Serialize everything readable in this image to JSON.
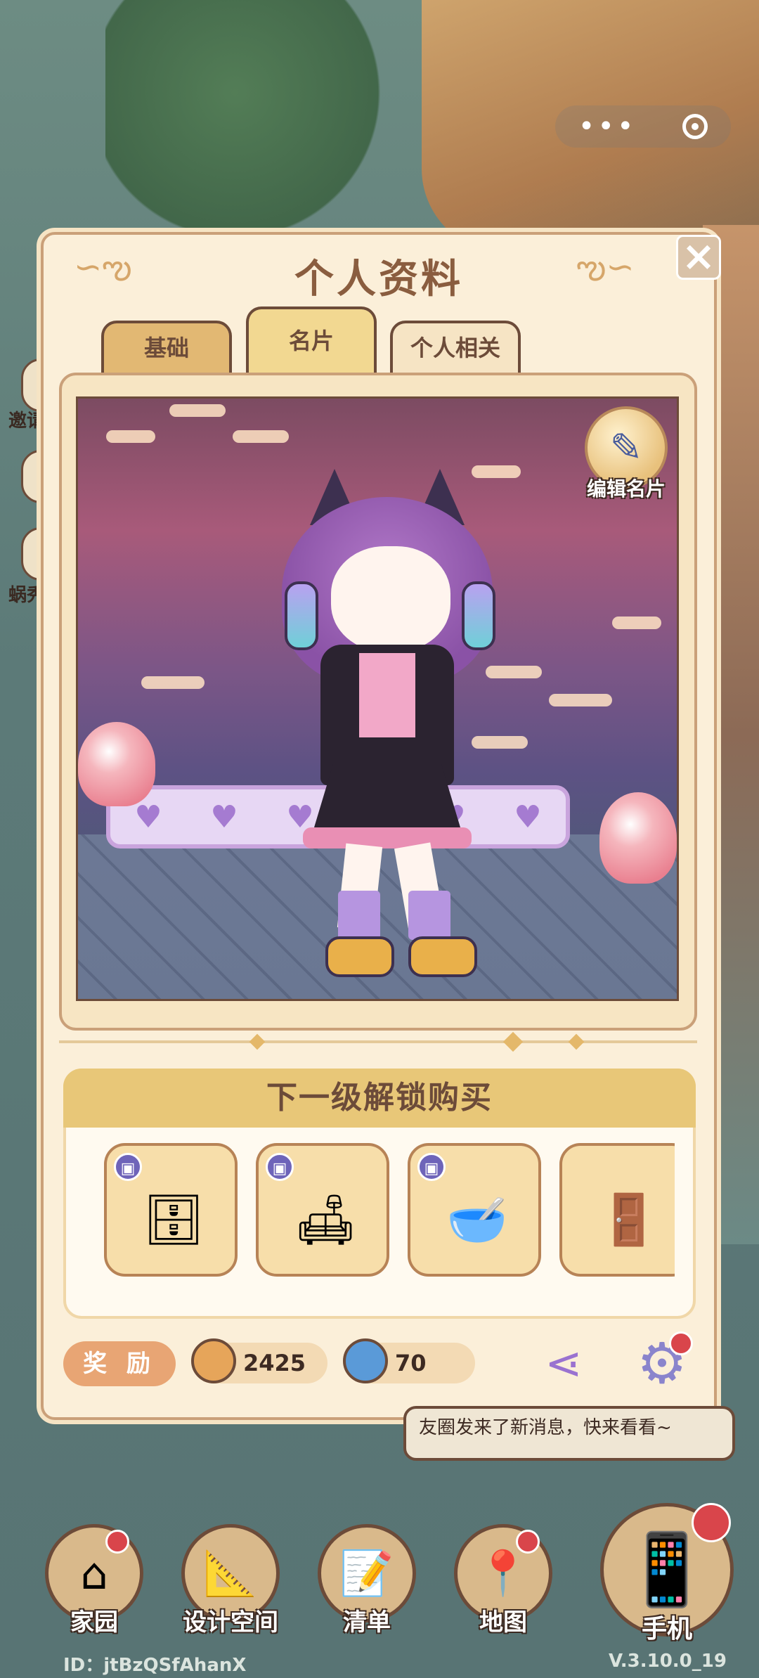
{
  "top_bar": {
    "menu_icon": "more-dots-icon",
    "record_icon": "target-icon"
  },
  "side": {
    "invite_label": "邀请",
    "snail_label": "蜗秀"
  },
  "panel": {
    "title": "个人资料",
    "close_icon": "close-icon",
    "tabs": [
      {
        "label": "基础",
        "active": false
      },
      {
        "label": "名片",
        "active": true
      },
      {
        "label": "个人相关",
        "active": false
      }
    ],
    "edit_card_label": "编辑名片",
    "unlock": {
      "title": "下一级解锁购买",
      "items": [
        {
          "icon": "stove-icon"
        },
        {
          "icon": "armchair-icon"
        },
        {
          "icon": "stand-mixer-icon"
        },
        {
          "icon": "shelf-icon"
        }
      ]
    },
    "reward_label": "奖 励",
    "currencies": [
      {
        "icon": "coin-icon",
        "value": "2425"
      },
      {
        "icon": "swirl-gem-icon",
        "value": "70"
      }
    ],
    "share_icon": "share-icon",
    "settings_icon": "gear-icon"
  },
  "notice": {
    "text": "友圈发来了新消息，快来看看~"
  },
  "nav": [
    {
      "label": "家园",
      "icon": "home-icon",
      "badge": true
    },
    {
      "label": "设计空间",
      "icon": "ruler-icon",
      "badge": false
    },
    {
      "label": "清单",
      "icon": "list-icon",
      "badge": false
    },
    {
      "label": "地图",
      "icon": "map-pin-icon",
      "badge": true
    },
    {
      "label": "手机",
      "icon": "phone-icon",
      "badge": true
    }
  ],
  "footer": {
    "user_id": "ID：jtBzQSfAhanX",
    "version": "V.3.10.0_19"
  },
  "colors": {
    "panel_bg": "#fbefd9",
    "accent_brown": "#6c4b39",
    "title": "#8a5d3f",
    "badge_red": "#d9454b"
  }
}
